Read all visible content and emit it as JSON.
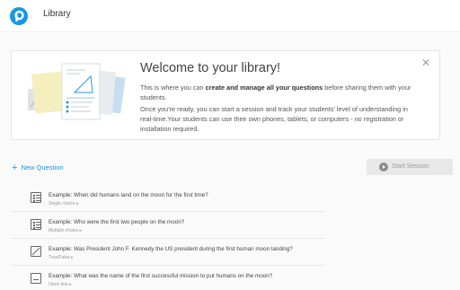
{
  "header": {
    "title": "Library"
  },
  "welcome": {
    "title": "Welcome to your library!",
    "p1_pre": "This is where you can ",
    "p1_bold": "create and manage all your questions",
    "p1_post": " before sharing them with your students.",
    "p2": "Once you're ready, you can start a session and track your students' level of understanding in real-time.Your students can use their own phones, tablets, or computers - no registration or installation required."
  },
  "actions": {
    "new_question": "New Question",
    "start_session": "Start Session"
  },
  "questions": [
    {
      "title": "Example: When did humans land on the moon for the first time?",
      "type": "Single choice ▸",
      "icon": "single-choice-icon"
    },
    {
      "title": "Example: Who were the first two people on the moon?",
      "type": "Multiple choice ▸",
      "icon": "multiple-choice-icon"
    },
    {
      "title": "Example: Was President John F. Kennedy the US president during the first human moon landing?",
      "type": "True/False ▸",
      "icon": "true-false-icon"
    },
    {
      "title": "Example: What was the name of the first successful mission to put humans on the moon?",
      "type": "Open text ▸",
      "icon": "open-text-icon"
    }
  ],
  "colors": {
    "brand": "#1a96e0",
    "disabled_button": "#e8e8e8"
  }
}
